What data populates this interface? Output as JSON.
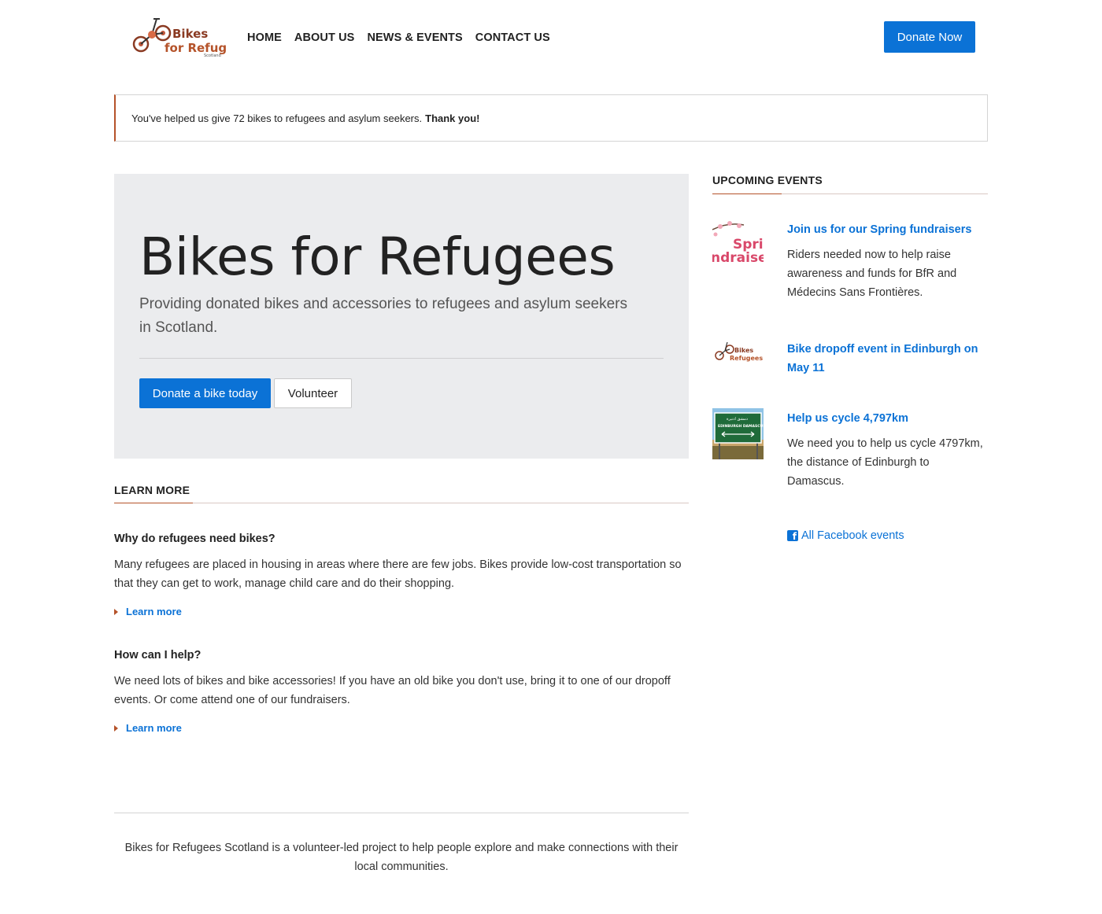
{
  "header": {
    "logo": {
      "line1": "Bikes",
      "line2": "for Refugees",
      "line3": "Scotland"
    },
    "nav": [
      "HOME",
      "ABOUT US",
      "NEWS & EVENTS",
      "CONTACT US"
    ],
    "donate_now": "Donate Now"
  },
  "alert": {
    "text": "You've helped us give 72 bikes to refugees and asylum seekers.",
    "thanks": "Thank you!"
  },
  "hero": {
    "title": "Bikes for Refugees",
    "lead": "Providing donated bikes and accessories to refugees and asylum seekers in Scotland.",
    "primary_button": "Donate a bike today",
    "secondary_button": "Volunteer"
  },
  "learn_more": {
    "heading": "LEARN MORE",
    "items": [
      {
        "title": "Why do refugees need bikes?",
        "body": "Many refugees are placed in housing in areas where there are few jobs. Bikes provide low-cost transportation so that they can get to work, manage child care and do their shopping.",
        "link": "Learn more"
      },
      {
        "title": "How can I help?",
        "body": "We need lots of bikes and bike accessories! If you have an old bike you don't use, bring it to one of our dropoff events. Or come attend one of our fundraisers.",
        "link": "Learn more"
      }
    ]
  },
  "events": {
    "heading": "UPCOMING EVENTS",
    "items": [
      {
        "title": "Join us for our Spring fundraisers",
        "desc": "Riders needed now to help raise awareness and funds for BfR and Médecins Sans Frontières.",
        "thumb_text": "Spri ndraise"
      },
      {
        "title": "Bike dropoff event in Edinburgh on May 11",
        "desc": "",
        "thumb_text": "Bikes for Refugees"
      },
      {
        "title": "Help us cycle 4,797km",
        "desc": "We need you to help us cycle 4797km, the distance of Edinburgh to Damascus.",
        "thumb_text": "EDINBURGH DAMASCUS"
      }
    ],
    "facebook_link": "All Facebook events"
  },
  "footer": {
    "text": "Bikes for Refugees Scotland is a volunteer-led project to help people explore and make connections with their local communities."
  },
  "colors": {
    "primary": "#0b72d6",
    "accent": "#b5532a",
    "hero_bg": "#ebecee"
  }
}
